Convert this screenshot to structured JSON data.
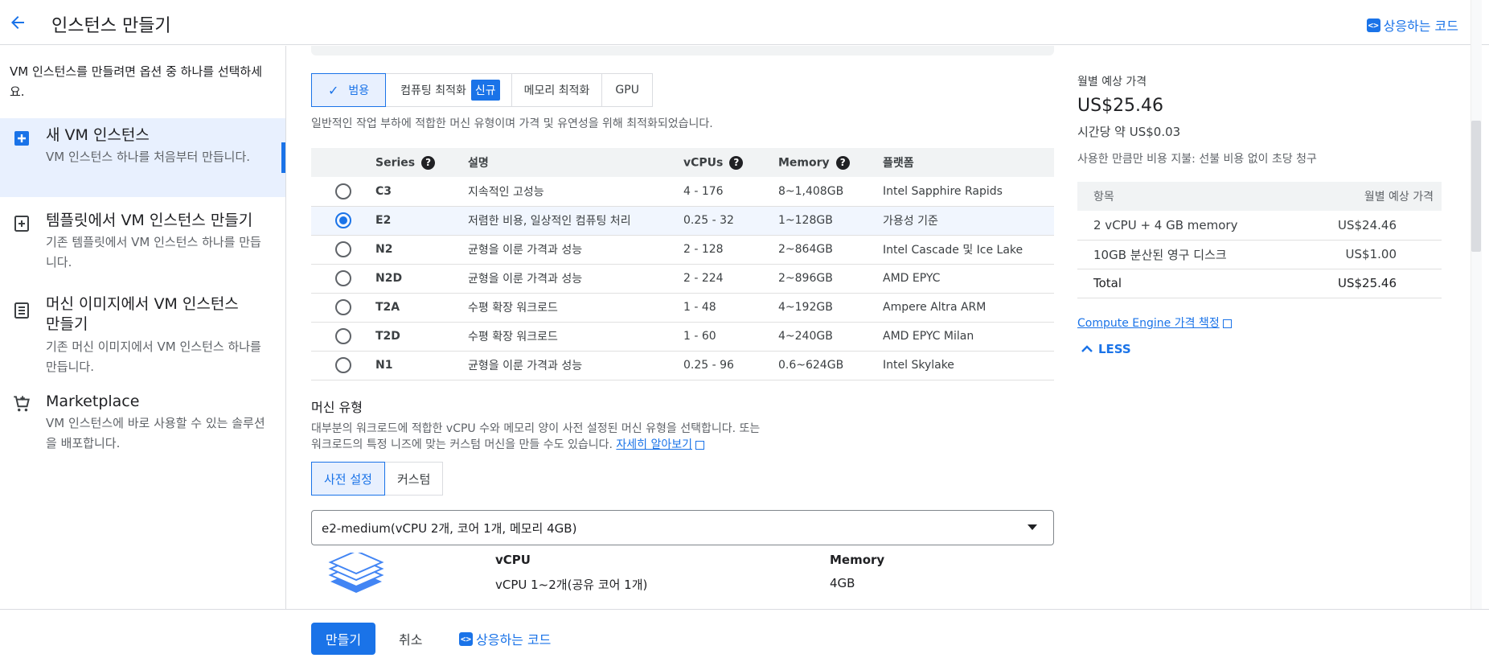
{
  "header": {
    "title": "인스턴스 만들기",
    "equivalent_code": "상응하는 코드"
  },
  "nav": {
    "intro": "VM 인스턴스를 만들려면 옵션 중 하나를 선택하세요.",
    "items": [
      {
        "title": "새 VM 인스턴스",
        "desc": "VM 인스턴스 하나를 처음부터 만듭니다."
      },
      {
        "title": "템플릿에서 VM 인스턴스 만들기",
        "desc": "기존 템플릿에서 VM 인스턴스 하나를 만듭니다."
      },
      {
        "title": "머신 이미지에서 VM 인스턴스 만들기",
        "desc": "기존 머신 이미지에서 VM 인스턴스 하나를 만듭니다."
      },
      {
        "title": "Marketplace",
        "desc": "VM 인스턴스에 바로 사용할 수 있는 솔루션을 배포합니다."
      }
    ]
  },
  "families": {
    "tabs": [
      "범용",
      "컴퓨팅 최적화",
      "메모리 최적화",
      "GPU"
    ],
    "new_badge": "신규",
    "description": "일반적인 작업 부하에 적합한 머신 유형이며 가격 및 유연성을 위해 최적화되었습니다."
  },
  "series_table": {
    "headers": {
      "series": "Series",
      "desc": "설명",
      "vcpus": "vCPUs",
      "memory": "Memory",
      "platform": "플랫폼"
    },
    "rows": [
      {
        "series": "C3",
        "desc": "지속적인 고성능",
        "vcpus": "4 - 176",
        "memory": "8~1,408GB",
        "platform": "Intel Sapphire Rapids"
      },
      {
        "series": "E2",
        "desc": "저렴한 비용, 일상적인 컴퓨팅 처리",
        "vcpus": "0.25 - 32",
        "memory": "1~128GB",
        "platform": "가용성 기준"
      },
      {
        "series": "N2",
        "desc": "균형을 이룬 가격과 성능",
        "vcpus": "2 - 128",
        "memory": "2~864GB",
        "platform": "Intel Cascade 및 Ice Lake"
      },
      {
        "series": "N2D",
        "desc": "균형을 이룬 가격과 성능",
        "vcpus": "2 - 224",
        "memory": "2~896GB",
        "platform": "AMD EPYC"
      },
      {
        "series": "T2A",
        "desc": "수평 확장 워크로드",
        "vcpus": "1 - 48",
        "memory": "4~192GB",
        "platform": "Ampere Altra ARM"
      },
      {
        "series": "T2D",
        "desc": "수평 확장 워크로드",
        "vcpus": "1 - 60",
        "memory": "4~240GB",
        "platform": "AMD EPYC Milan"
      },
      {
        "series": "N1",
        "desc": "균형을 이룬 가격과 성능",
        "vcpus": "0.25 - 96",
        "memory": "0.6~624GB",
        "platform": "Intel Skylake"
      }
    ],
    "selected": "E2"
  },
  "machine_type": {
    "title": "머신 유형",
    "desc_line1": "대부분의 워크로드에 적합한 vCPU 수와 메모리 양이 사전 설정된 머신 유형을 선택합니다. 또는",
    "desc_line2": "워크로드의 특정 니즈에 맞는 커스텀 머신을 만들 수도 있습니다.",
    "learn_more": "자세히 알아보기",
    "tabs": [
      "사전 설정",
      "커스텀"
    ],
    "selected_value": "e2-medium(vCPU 2개, 코어 1개, 메모리 4GB)",
    "vcpu_label": "vCPU",
    "vcpu_value": "vCPU 1~2개(공유 코어 1개)",
    "memory_label": "Memory",
    "memory_value": "4GB"
  },
  "pricing": {
    "label": "월별 예상 가격",
    "monthly": "US$25.46",
    "hourly": "시간당 약 US$0.03",
    "note": "사용한 만큼만 비용 지불: 선불 비용 없이 초당 청구",
    "table_headers": {
      "item": "항목",
      "price": "월별 예상 가격"
    },
    "rows": [
      {
        "item": "2 vCPU + 4 GB memory",
        "price": "US$24.46"
      },
      {
        "item": "10GB 분산된 영구 디스크",
        "price": "US$1.00"
      },
      {
        "item": "Total",
        "price": "US$25.46"
      }
    ],
    "ce_link": "Compute Engine 가격 책정",
    "less": "LESS"
  },
  "footer": {
    "create": "만들기",
    "cancel": "취소",
    "equivalent_code": "상응하는 코드"
  },
  "colors": {
    "accent": "#1a73e8",
    "selected_bg": "#e8f0fe"
  }
}
